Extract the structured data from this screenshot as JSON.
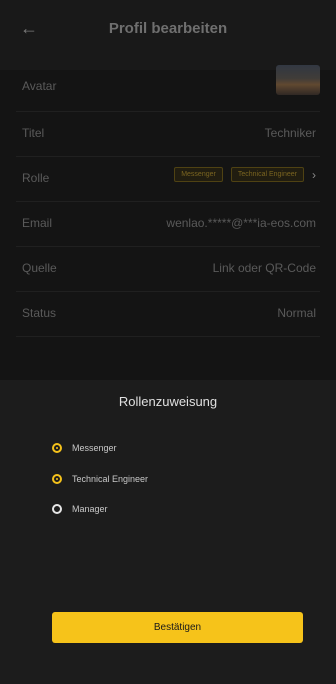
{
  "header": {
    "back_icon": "arrow-left-icon",
    "title": "Profil bearbeiten"
  },
  "profile": {
    "rows": [
      {
        "label": "Avatar",
        "value": ""
      },
      {
        "label": "Titel",
        "value": "Techniker"
      },
      {
        "label": "Rolle",
        "value": ""
      },
      {
        "label": "Email",
        "value": "wenlao.*****@***ia-eos.com"
      },
      {
        "label": "Quelle",
        "value": "Link oder QR-Code"
      },
      {
        "label": "Status",
        "value": "Normal"
      }
    ],
    "role_tags": [
      "Messenger",
      "Technical Engineer"
    ]
  },
  "sheet": {
    "title": "Rollenzuweisung",
    "options": [
      {
        "label": "Messenger",
        "checked": true
      },
      {
        "label": "Technical Engineer",
        "checked": true
      },
      {
        "label": "Manager",
        "checked": false
      }
    ],
    "confirm_label": "Bestätigen"
  },
  "colors": {
    "accent": "#f6c31a",
    "background": "#141414",
    "sheet": "#1c1c1c"
  }
}
